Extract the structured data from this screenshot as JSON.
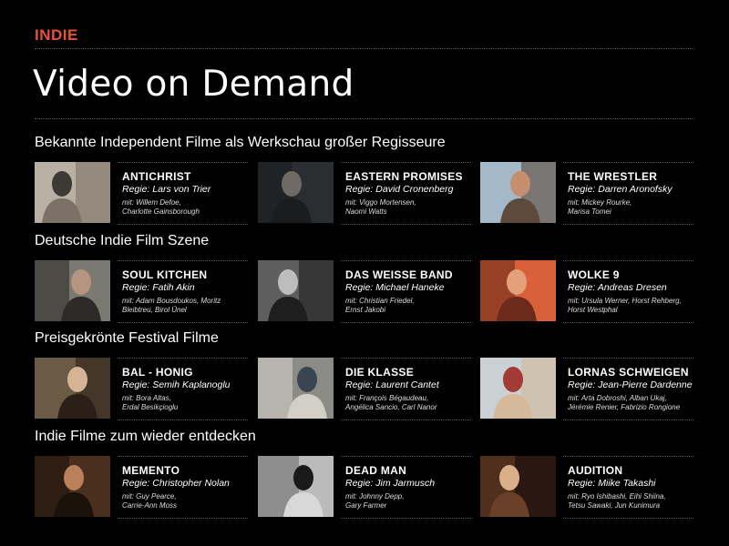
{
  "brand": "INDIE",
  "title": "Video on Demand",
  "sections": [
    {
      "heading": "Bekannte Independent Filme als Werkschau großer Regisseure",
      "films": [
        {
          "title": "ANTICHRIST",
          "director": "Regie: Lars von Trier",
          "cast_line1": "mit: Willem Defoe,",
          "cast_line2": "Charlotte Gainsborough",
          "thumb_colors": [
            "#b9b0a4",
            "#3d3a36",
            "#7b7166"
          ]
        },
        {
          "title": "EASTERN PROMISES",
          "director": "Regie: David Cronenberg",
          "cast_line1": "mit: Viggo Mortensen,",
          "cast_line2": "Naomi Watts",
          "thumb_colors": [
            "#2a2e30",
            "#6f6a64",
            "#1a1c1e"
          ]
        },
        {
          "title": "THE WRESTLER",
          "director": "Regie: Darren Aronofsky",
          "cast_line1": "mit: Mickey Rourke,",
          "cast_line2": "Marisa Tomei",
          "thumb_colors": [
            "#a3b8c9",
            "#c48e6f",
            "#5d4a3c"
          ]
        }
      ]
    },
    {
      "heading": "Deutsche Indie Film Szene",
      "films": [
        {
          "title": "SOUL KITCHEN",
          "director": "Regie: Fatih Akin",
          "cast_line1": "mit: Adam Bousdoukos, Moritz",
          "cast_line2": "Bleibtreu, Birol Ünel",
          "thumb_colors": [
            "#7a7a72",
            "#b59580",
            "#2d2b29"
          ]
        },
        {
          "title": "DAS WEISSE BAND",
          "director": "Regie: Michael Haneke",
          "cast_line1": "mit: Christian Friedel,",
          "cast_line2": "Ernst Jakobi",
          "thumb_colors": [
            "#5e5e5e",
            "#bdbdbd",
            "#1e1e1e"
          ]
        },
        {
          "title": "WOLKE 9",
          "director": "Regie: Andreas Dresen",
          "cast_line1": "mit: Ursula Werner, Horst Rehberg,",
          "cast_line2": "Horst Westphal",
          "thumb_colors": [
            "#d9603a",
            "#e3a07a",
            "#6b2a1a"
          ]
        }
      ]
    },
    {
      "heading": "Preisgekrönte Festival Filme",
      "films": [
        {
          "title": "BAL - HONIG",
          "director": "Regie: Semih Kaplanoglu",
          "cast_line1": "mit: Bora Altas,",
          "cast_line2": "Erdal Besikçioglu",
          "thumb_colors": [
            "#6b5a45",
            "#d6b394",
            "#2a2018"
          ]
        },
        {
          "title": "DIE KLASSE",
          "director": "Regie: Laurent Cantet",
          "cast_line1": "mit: François Bégaudeau,",
          "cast_line2": "Angélica Sancio, Carl Nanor",
          "thumb_colors": [
            "#8c8c86",
            "#3a4550",
            "#d2cfc6"
          ]
        },
        {
          "title": "LORNAS SCHWEIGEN",
          "director": "Regie: Jean-Pierre Dardenne",
          "cast_line1": "mit: Arta Dobroshi, Alban Ukaj,",
          "cast_line2": "Jérémie Renier, Fabrizio Rongione",
          "thumb_colors": [
            "#c9d1d4",
            "#a33a35",
            "#d6b89a"
          ]
        }
      ]
    },
    {
      "heading": "Indie Filme zum wieder entdecken",
      "films": [
        {
          "title": "MEMENTO",
          "director": "Regie: Christopher Nolan",
          "cast_line1": "mit: Guy Pearce,",
          "cast_line2": "Carrie-Ann Moss",
          "thumb_colors": [
            "#4a2e1e",
            "#b9805a",
            "#1c120c"
          ]
        },
        {
          "title": "DEAD MAN",
          "director": "Regie: Jim Jarmusch",
          "cast_line1": "mit: Johnny Depp,",
          "cast_line2": "Gary Farmer",
          "thumb_colors": [
            "#8e8e8e",
            "#1a1a1a",
            "#d8d8d8"
          ]
        },
        {
          "title": "AUDITION",
          "director": "Regie: Miike Takashi",
          "cast_line1": "mit: Ryo Ishibashi, Eihi Shiina,",
          "cast_line2": "Tetsu Sawaki, Jun Kunimura",
          "thumb_colors": [
            "#2a1810",
            "#d9b089",
            "#6a4028"
          ]
        }
      ]
    }
  ],
  "colors": {
    "brand_accent": "#e8513b",
    "background": "#000000",
    "divider": "#555555"
  }
}
